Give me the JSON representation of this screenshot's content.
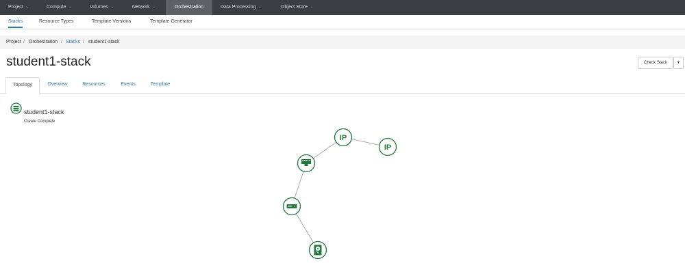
{
  "topnav": {
    "items": [
      {
        "label": "Project"
      },
      {
        "label": "Compute"
      },
      {
        "label": "Volumes"
      },
      {
        "label": "Network"
      },
      {
        "label": "Orchestration"
      },
      {
        "label": "Data Processing"
      },
      {
        "label": "Object Store"
      }
    ],
    "caret": "⌄"
  },
  "subnav": {
    "items": [
      {
        "label": "Stacks"
      },
      {
        "label": "Resource Types"
      },
      {
        "label": "Template Versions"
      },
      {
        "label": "Template Generator"
      }
    ]
  },
  "breadcrumb": {
    "project": "Project",
    "orchestration": "Orchestration",
    "stacks": "Stacks",
    "current": "student1-stack",
    "separator": "/"
  },
  "page": {
    "title": "student1-stack",
    "check_stack_label": "Check Stack",
    "dropdown_caret": "▾"
  },
  "tabs": [
    {
      "label": "Topology"
    },
    {
      "label": "Overview"
    },
    {
      "label": "Resources"
    },
    {
      "label": "Events"
    },
    {
      "label": "Template"
    }
  ],
  "stack": {
    "name": "student1-stack",
    "status": "Create Complete"
  },
  "topology": {
    "colors": {
      "node_stroke": "#1e7a3a",
      "edge": "#aaaaaa",
      "accent": "#2a7ab5"
    },
    "nodes": [
      {
        "id": "ip1",
        "label": "IP",
        "icon": "floating-ip-icon"
      },
      {
        "id": "ip2",
        "label": "IP",
        "icon": "floating-ip-icon"
      },
      {
        "id": "port",
        "label": "",
        "icon": "port-icon"
      },
      {
        "id": "server",
        "label": "",
        "icon": "server-icon"
      },
      {
        "id": "volume",
        "label": "",
        "icon": "volume-icon"
      }
    ]
  }
}
